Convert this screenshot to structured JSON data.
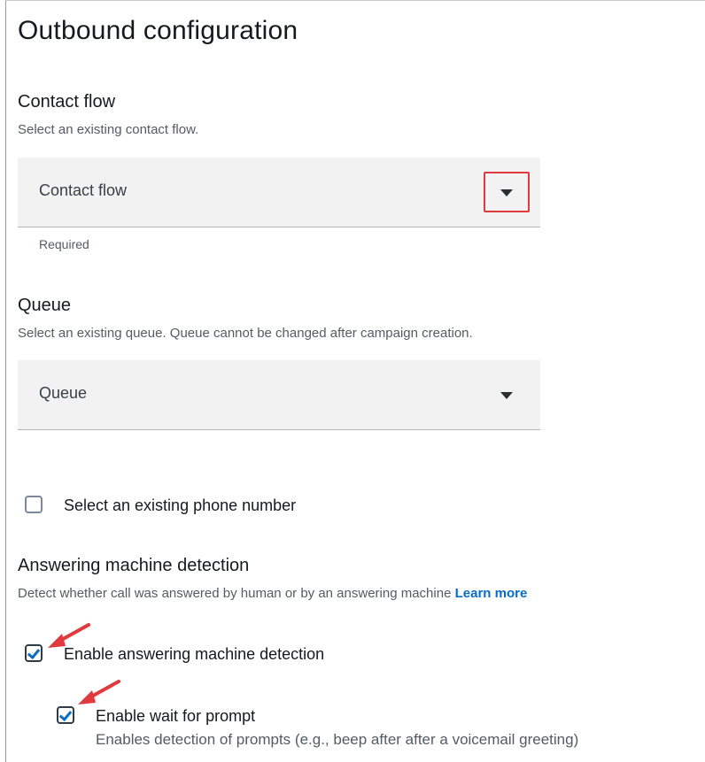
{
  "header": {
    "title": "Outbound configuration"
  },
  "contact_flow": {
    "label": "Contact flow",
    "description": "Select an existing contact flow.",
    "placeholder": "Contact flow",
    "constraint": "Required"
  },
  "queue": {
    "label": "Queue",
    "description": "Select an existing queue. Queue cannot be changed after campaign creation.",
    "placeholder": "Queue"
  },
  "phone_number": {
    "label": "Select an existing phone number",
    "checked": false
  },
  "amd": {
    "title": "Answering machine detection",
    "description": "Detect whether call was answered by human or by an answering machine",
    "learn_more": "Learn more",
    "enable": {
      "label": "Enable answering machine detection",
      "checked": true
    },
    "wait_prompt": {
      "label": "Enable wait for prompt",
      "description": "Enables detection of prompts (e.g., beep after after a voicemail greeting)",
      "checked": true
    }
  },
  "colors": {
    "highlight": "#e0393e",
    "accent": "#0a6cc2"
  },
  "icons": [
    "caret-down-icon",
    "checkmark-icon",
    "annotation-arrow-icon"
  ]
}
